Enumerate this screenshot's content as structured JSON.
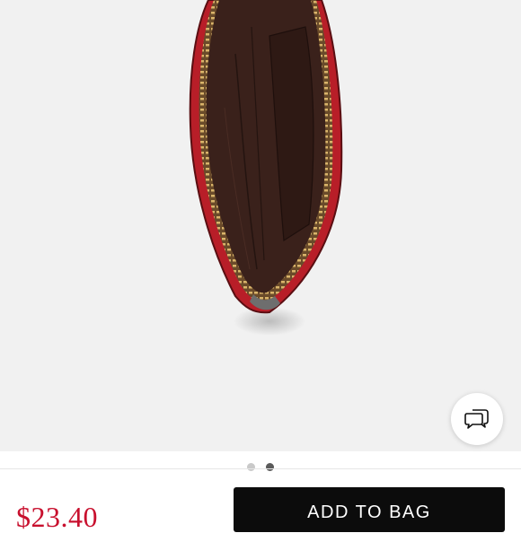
{
  "product": {
    "price": "$23.40",
    "add_to_bag_label": "ADD TO BAG"
  },
  "carousel": {
    "dot_count": 2,
    "active_index": 1
  },
  "icons": {
    "chat": "chat-bubbles-icon"
  },
  "colors": {
    "price": "#c8102e",
    "button_bg": "#0c0c0c",
    "button_text": "#ffffff",
    "image_bg": "#f1f1f1",
    "pouch_red": "#b81e28",
    "pouch_lining": "#3a211b",
    "zipper_gold": "#c8a25a"
  }
}
